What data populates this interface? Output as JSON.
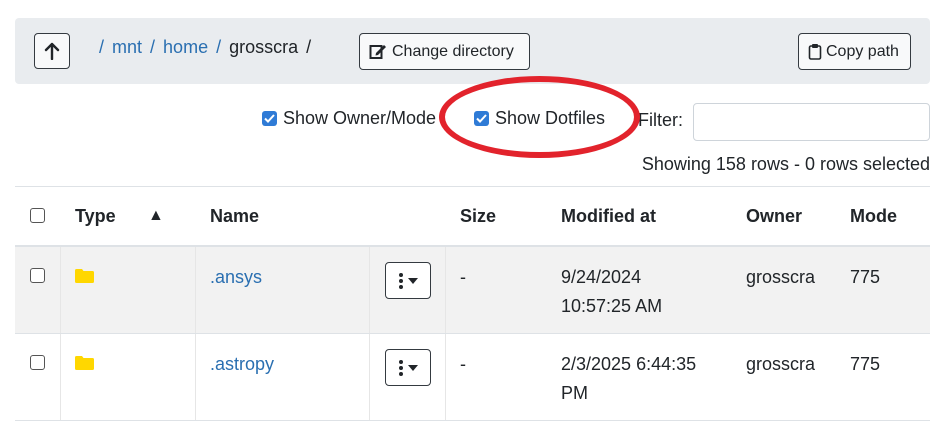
{
  "toolbar": {
    "breadcrumbs": [
      {
        "label": "/",
        "kind": "sep"
      },
      {
        "label": "mnt",
        "kind": "link"
      },
      {
        "label": "/",
        "kind": "sep"
      },
      {
        "label": "home",
        "kind": "link"
      },
      {
        "label": "/",
        "kind": "sep"
      },
      {
        "label": "grosscra",
        "kind": "current"
      },
      {
        "label": "/",
        "kind": "plain"
      }
    ],
    "change_directory_label": "Change directory",
    "copy_path_label": "Copy path"
  },
  "options": {
    "show_owner_mode_label": "Show Owner/Mode",
    "show_owner_mode_checked": true,
    "show_dotfiles_label": "Show Dotfiles",
    "show_dotfiles_checked": true,
    "filter_label": "Filter:",
    "filter_value": ""
  },
  "row_count_text": "Showing 158 rows - 0 rows selected",
  "table": {
    "columns": [
      "Type",
      "Name",
      "Size",
      "Modified at",
      "Owner",
      "Mode"
    ],
    "sort_indicator": "▲",
    "rows": [
      {
        "type": "folder",
        "name": ".ansys",
        "size": "-",
        "modified_line1": "9/24/2024",
        "modified_line2": "10:57:25 AM",
        "owner": "grosscra",
        "mode": "775"
      },
      {
        "type": "folder",
        "name": ".astropy",
        "size": "-",
        "modified_line1": "2/3/2025 6:44:35",
        "modified_line2": "PM",
        "owner": "grosscra",
        "mode": "775"
      }
    ]
  },
  "colors": {
    "link": "#2a6fb1",
    "highlight_circle": "#e2232c",
    "checkbox": "#2f7bd6",
    "folder": "#ffd700"
  }
}
